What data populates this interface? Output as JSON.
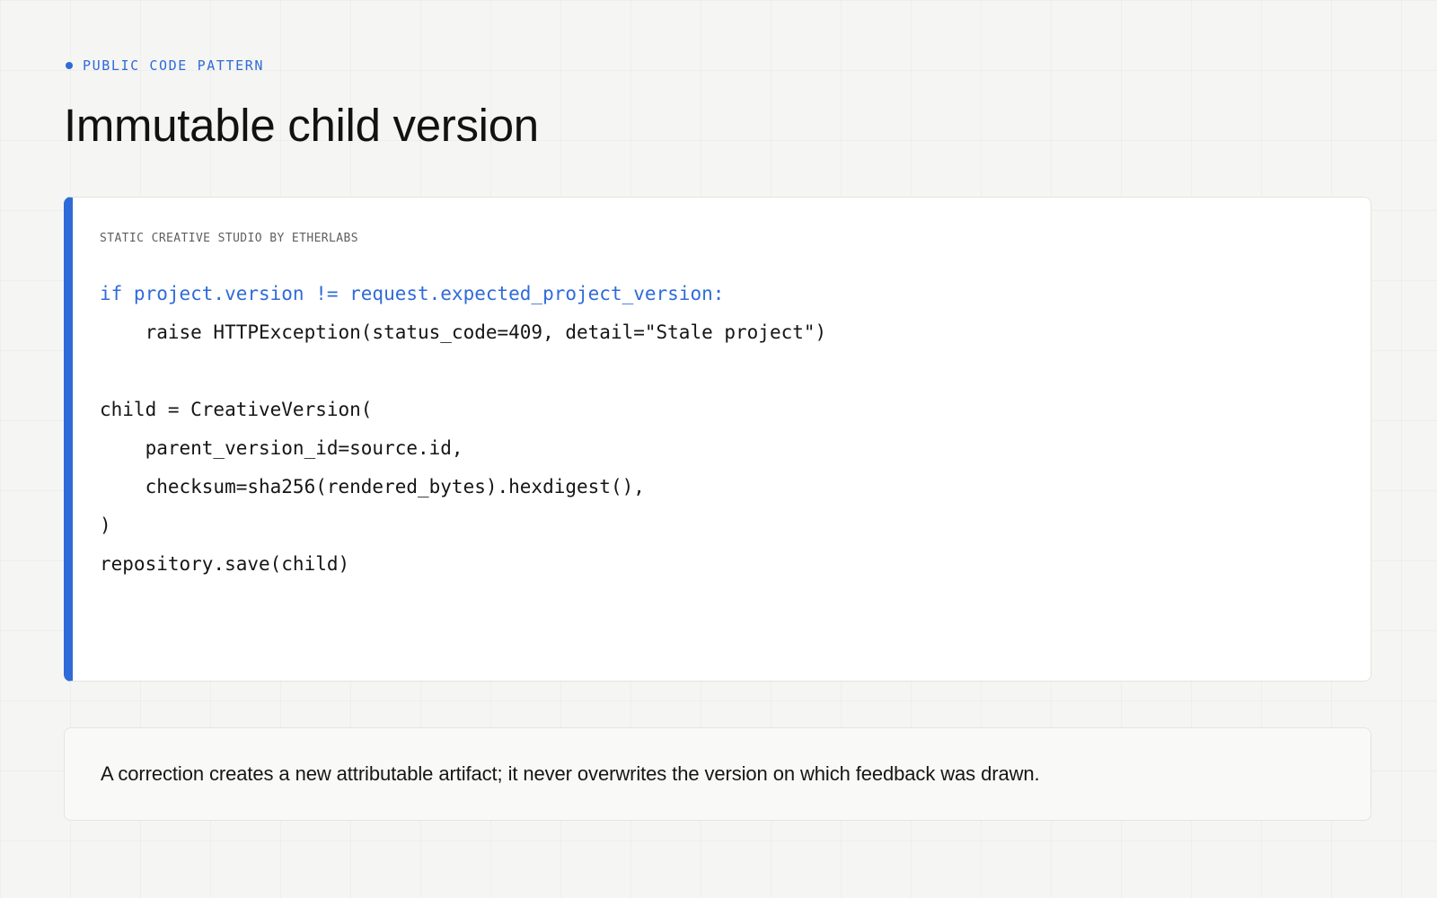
{
  "header": {
    "eyebrow": "PUBLIC CODE PATTERN",
    "title": "Immutable child version"
  },
  "code_card": {
    "label": "STATIC CREATIVE STUDIO BY ETHERLABS",
    "lines": [
      "if project.version != request.expected_project_version:",
      "    raise HTTPException(status_code=409, detail=\"Stale project\")",
      "",
      "child = CreativeVersion(",
      "    parent_version_id=source.id,",
      "    checksum=sha256(rendered_bytes).hexdigest(),",
      ")",
      "repository.save(child)"
    ]
  },
  "note": {
    "text": "A correction creates a new attributable artifact; it never overwrites the version on which feedback was drawn."
  },
  "colors": {
    "accent": "#2f6bd8",
    "background": "#f5f5f3",
    "card": "#ffffff",
    "text": "#141414"
  }
}
